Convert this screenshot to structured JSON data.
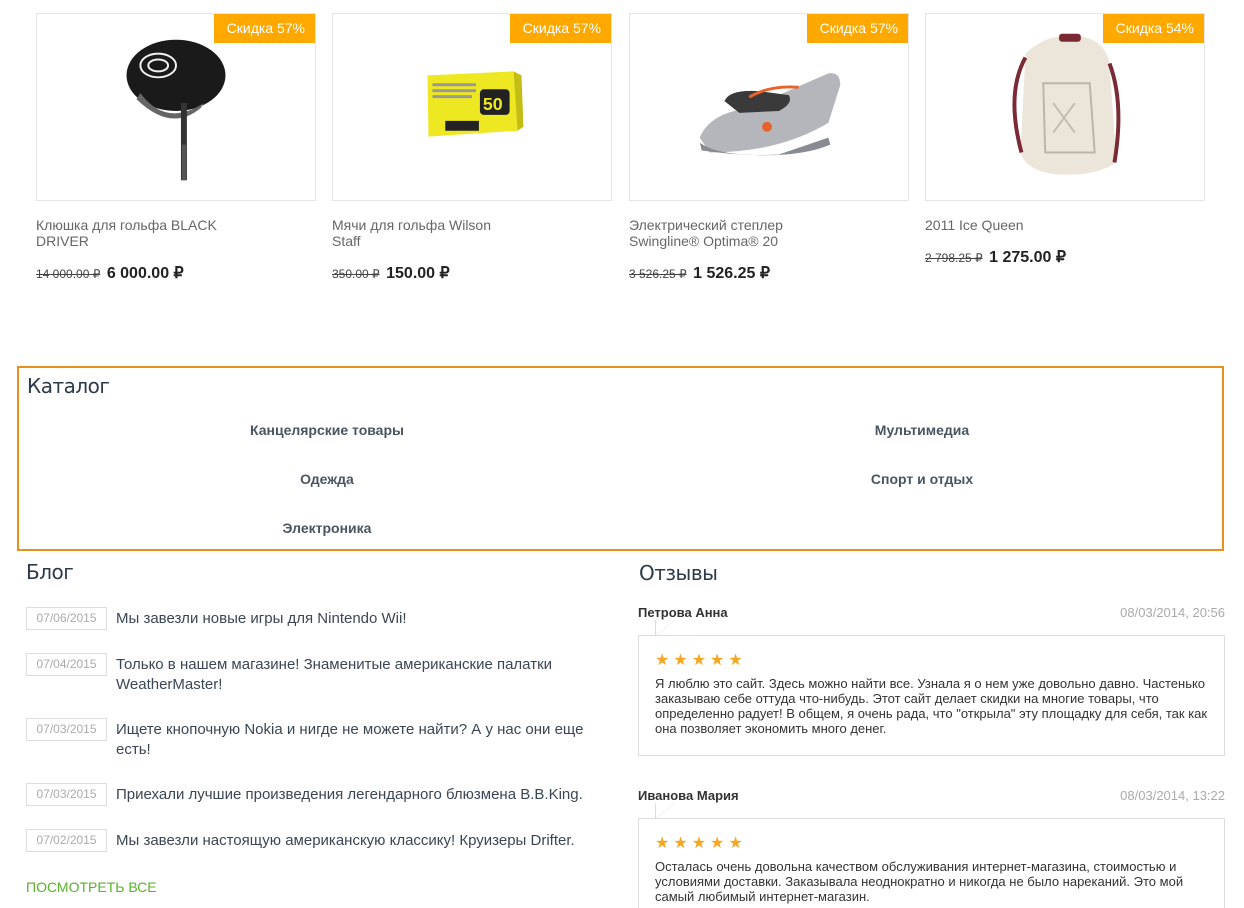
{
  "colors": {
    "badge": "#ffa800",
    "catalog_border": "#e8901d",
    "link_green": "#59b22b",
    "star": "#f5a623"
  },
  "products": [
    {
      "badge": "Скидка 57%",
      "name": "Клюшка для гольфа BLACK DRIVER",
      "old_price": "14 000.00 ₽",
      "new_price": "6 000.00 ₽",
      "icon": "golf-driver-image"
    },
    {
      "badge": "Скидка 57%",
      "name": "Мячи для гольфа Wilson Staff",
      "old_price": "350.00 ₽",
      "new_price": "150.00 ₽",
      "icon": "golf-balls-box-image"
    },
    {
      "badge": "Скидка 57%",
      "name": "Электрический степлер Swingline® Optima® 20",
      "old_price": "3 526.25 ₽",
      "new_price": "1 526.25 ₽",
      "icon": "stapler-image"
    },
    {
      "badge": "Скидка 54%",
      "name": "2011 Ice Queen",
      "old_price": "2 798.25 ₽",
      "new_price": "1 275.00 ₽",
      "icon": "backpack-image"
    }
  ],
  "catalog": {
    "title": "Каталог",
    "items": [
      "Канцелярские товары",
      "Мультимедиа",
      "Одежда",
      "Спорт и отдых",
      "Электроника"
    ]
  },
  "blog": {
    "title": "Блог",
    "items": [
      {
        "date": "07/06/2015",
        "text": "Мы завезли новые игры для Nintendo Wii!"
      },
      {
        "date": "07/04/2015",
        "text": "Только в нашем магазине! Знаменитые американские палатки WeatherMaster!"
      },
      {
        "date": "07/03/2015",
        "text": "Ищете кнопочную Nokia и нигде не можете найти? А у нас они еще есть!"
      },
      {
        "date": "07/03/2015",
        "text": "Приехали лучшие произведения легендарного блюзмена B.B.King."
      },
      {
        "date": "07/02/2015",
        "text": "Мы завезли настоящую американскую классику! Круизеры Drifter."
      }
    ],
    "view_all": "ПОСМОТРЕТЬ ВСЕ"
  },
  "reviews": {
    "title": "Отзывы",
    "items": [
      {
        "author": "Петрова Анна",
        "date": "08/03/2014, 20:56",
        "rating": 5,
        "stars": "★★★★★",
        "text": "Я люблю это сайт. Здесь можно найти все. Узнала я о нем уже довольно давно. Частенько заказываю себе оттуда что-нибудь. Этот сайт делает скидки на многие товары, что определенно радует! В общем, я очень рада, что \"открыла\" эту площадку для себя, так как она позволяет экономить много денег."
      },
      {
        "author": "Иванова Мария",
        "date": "08/03/2014, 13:22",
        "rating": 5,
        "stars": "★★★★★",
        "text": "Осталась очень довольна качеством обслуживания интернет-магазина, стоимостью и условиями доставки. Заказывала неоднократно и никогда не было нареканий. Это мой самый любимый интернет-магазин."
      }
    ]
  }
}
